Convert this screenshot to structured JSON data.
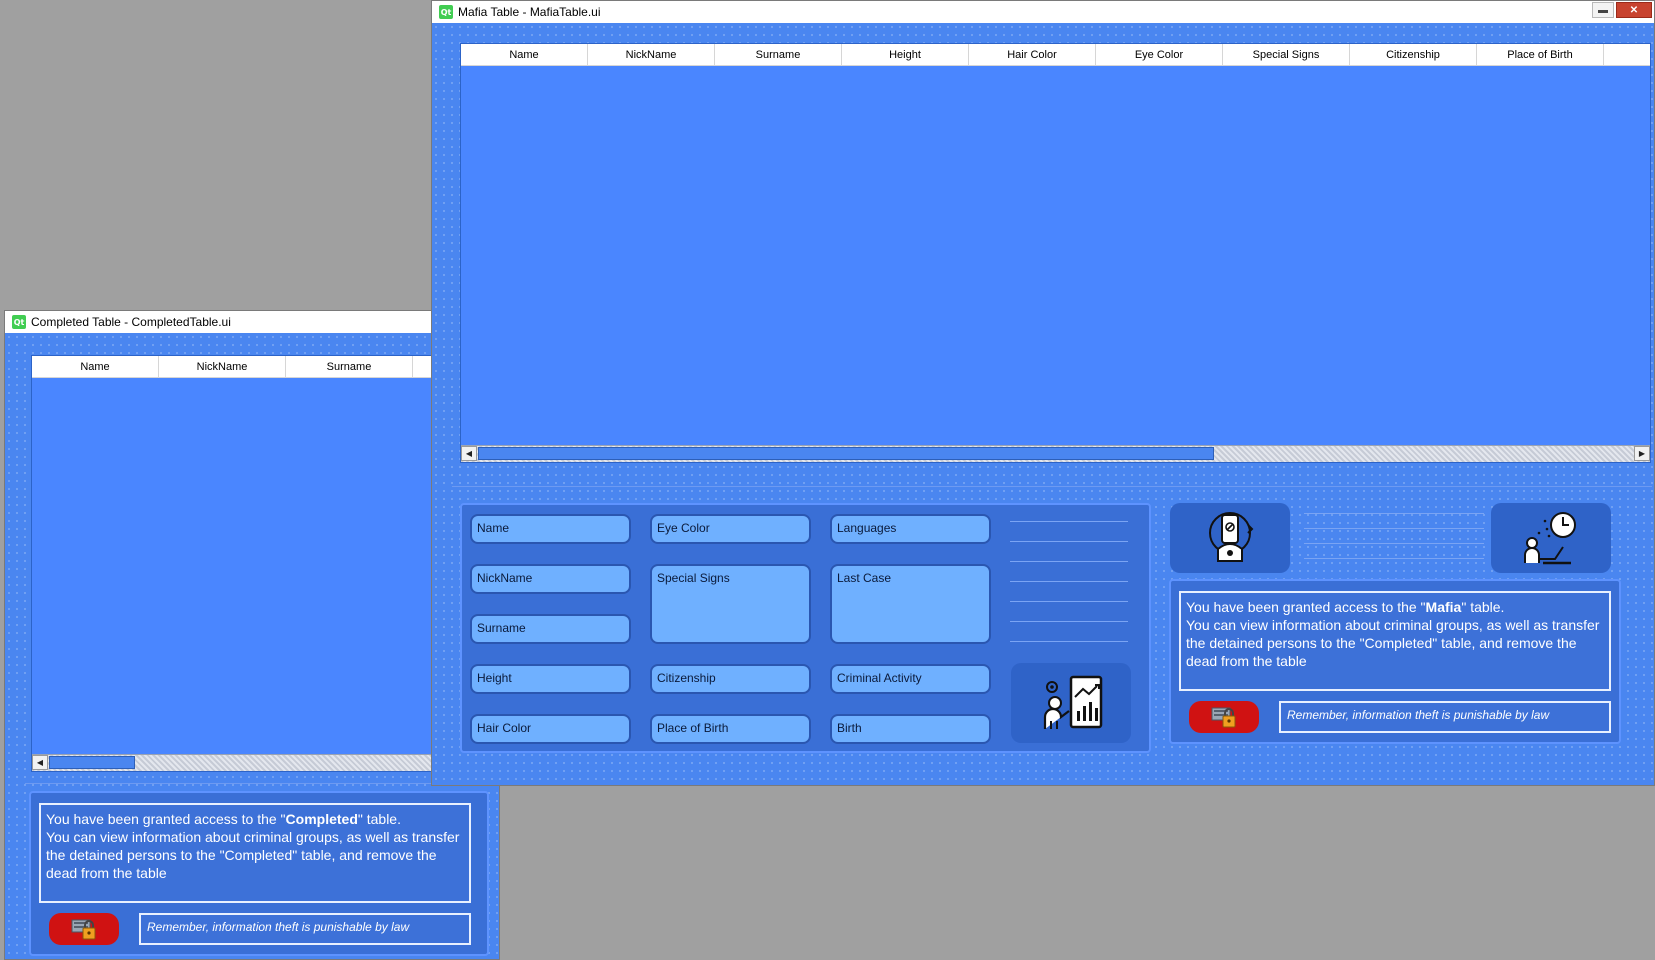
{
  "completed_window": {
    "title": "Completed Table - CompletedTable.ui",
    "columns": [
      "Name",
      "NickName",
      "Surname"
    ],
    "info_prefix": "You have been granted access to the \"",
    "info_table_name": "Completed",
    "info_suffix": "\" table.",
    "info_rest": "You can view information about criminal groups, as well as transfer the detained persons to the \"Completed\" table, and remove the dead from the table",
    "warning": "Remember, information theft is punishable by law"
  },
  "mafia_window": {
    "title": "Mafia Table - MafiaTable.ui",
    "columns": [
      "Name",
      "NickName",
      "Surname",
      "Height",
      "Hair Color",
      "Eye Color",
      "Special Signs",
      "Citizenship",
      "Place of Birth"
    ],
    "fields": {
      "name": "Name",
      "nickname": "NickName",
      "surname": "Surname",
      "height": "Height",
      "hair_color": "Hair Color",
      "eye_color": "Eye Color",
      "special_signs": "Special Signs",
      "citizenship": "Citizenship",
      "place_of_birth": "Place of Birth",
      "languages": "Languages",
      "last_case": "Last Case",
      "criminal_activity": "Criminal Activity",
      "birth": "Birth"
    },
    "info_prefix": "You have been granted access to the \"",
    "info_table_name": "Mafia",
    "info_suffix": "\" table.",
    "info_rest": "You can view information about criminal groups, as well as transfer the detained persons to the \"Completed\" table, and remove the dead from the table",
    "warning": "Remember, information theft is punishable by law"
  },
  "icons": {
    "app_logo": "Qt",
    "minimize": "minimize-icon",
    "close": "close-icon",
    "report": "presentation-chart-icon",
    "device": "mobile-security-icon",
    "clock": "person-clock-icon",
    "lock": "lock-database-icon"
  },
  "colors": {
    "window_bg": "#4a86f0",
    "field_bg": "#6fb0ff",
    "lock_button": "#d01212",
    "desktop": "#a0a0a0"
  }
}
